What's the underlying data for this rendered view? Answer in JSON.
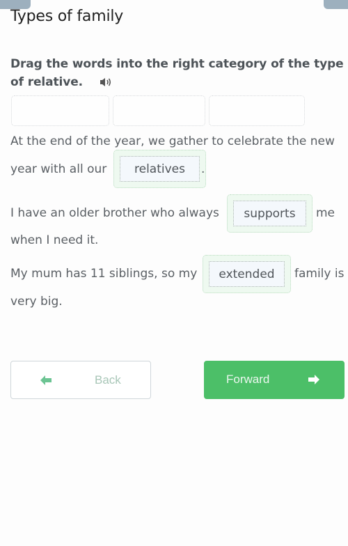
{
  "page": {
    "title": "Types of family",
    "instruction": "Drag the words into the right category of the type of relative.",
    "audio_icon": "speaker-icon"
  },
  "word_bank": {
    "slots": [
      {
        "label": ""
      },
      {
        "label": ""
      },
      {
        "label": ""
      }
    ]
  },
  "sentences": [
    {
      "line1": "At the end of the year, we gather to celebrate the new",
      "before": "year with all our",
      "answer": "relatives",
      "after": "."
    },
    {
      "before": "I have an older brother who always",
      "answer": "supports",
      "after": "me",
      "line2": "when I need it."
    },
    {
      "before": "My mum has 11 siblings, so my",
      "answer": "extended",
      "after": "family is",
      "line2": "very big."
    }
  ],
  "navigation": {
    "back_label": "Back",
    "back_icon": "arrow-left-icon",
    "forward_label": "Forward",
    "forward_icon": "arrow-right-icon"
  },
  "colors": {
    "accent_green": "#4cbf68",
    "drop_bg": "#eef9f0",
    "chip_bg": "#f4f8fc",
    "corner_tab": "#9db0be"
  }
}
